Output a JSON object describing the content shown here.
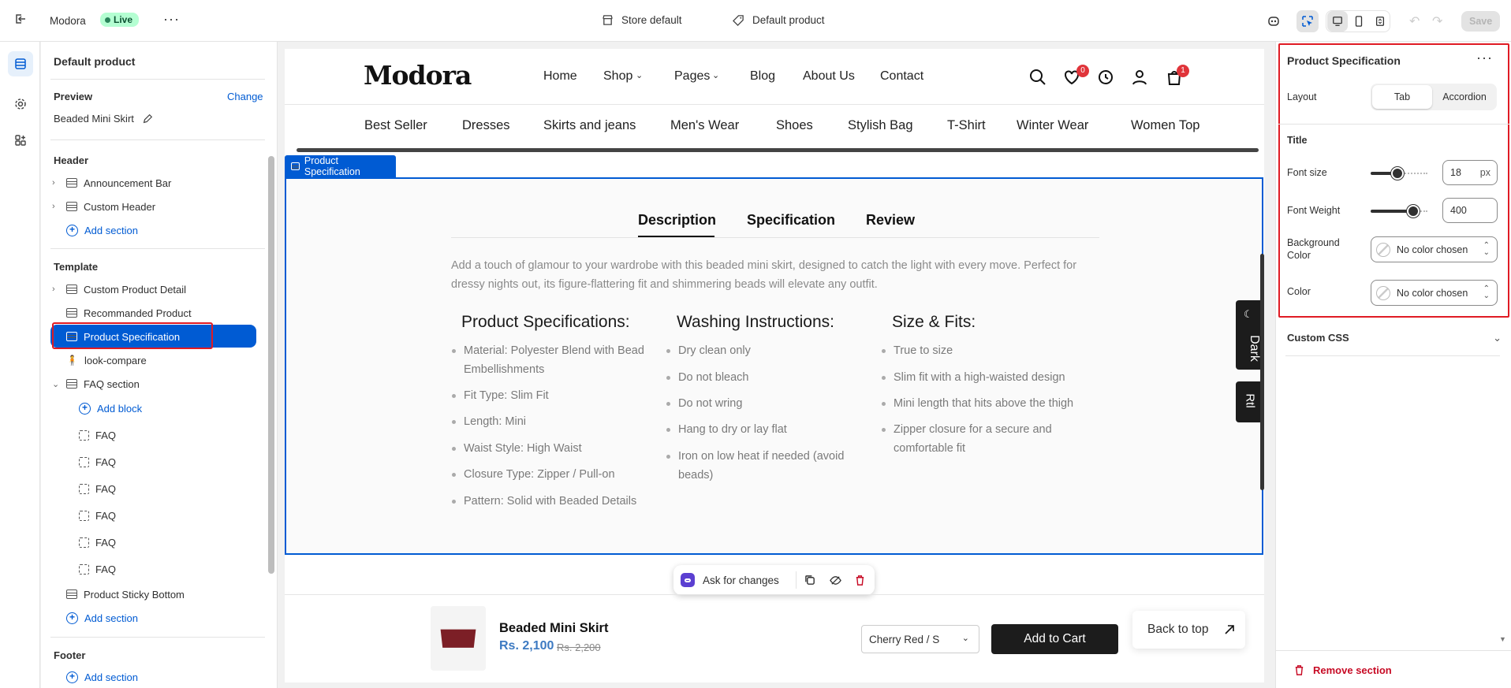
{
  "topbar": {
    "app_name": "Modora",
    "live": "Live",
    "store_default": "Store default",
    "default_product": "Default product",
    "save": "Save"
  },
  "left": {
    "title": "Default product",
    "preview_label": "Preview",
    "change": "Change",
    "preview_value": "Beaded Mini Skirt",
    "header_label": "Header",
    "header_items": [
      "Announcement Bar",
      "Custom Header"
    ],
    "add_section": "Add section",
    "template_label": "Template",
    "template_items": [
      "Custom Product Detail",
      "Recommanded Product",
      "Product Specification",
      "look-compare",
      "FAQ section"
    ],
    "add_block": "Add block",
    "faq": "FAQ",
    "sticky": "Product Sticky Bottom",
    "footer_label": "Footer"
  },
  "store": {
    "logo": "Modora",
    "nav": [
      "Home",
      "Shop",
      "Pages",
      "Blog",
      "About Us",
      "Contact"
    ],
    "wishlist_count": "0",
    "cart_count": "1",
    "categories": [
      "Best Seller",
      "Dresses",
      "Skirts and jeans",
      "Men's Wear",
      "Shoes",
      "Stylish Bag",
      "T-Shirt",
      "Winter Wear",
      "Women Top"
    ]
  },
  "section": {
    "tag": "Product Specification",
    "tabs": [
      "Description",
      "Specification",
      "Review"
    ],
    "description": "Add a touch of glamour to your wardrobe with this beaded mini skirt, designed to catch the light with every move. Perfect for dressy nights out, its figure-flattering fit and shimmering beads will elevate any outfit.",
    "col1_title": "Product Specifications:",
    "col1": [
      "Material: Polyester Blend with Bead Embellishments",
      "Fit Type: Slim Fit",
      "Length: Mini",
      "Waist Style: High Waist",
      "Closure Type: Zipper / Pull-on",
      "Pattern: Solid with Beaded Details"
    ],
    "col2_title": "Washing Instructions:",
    "col2": [
      "Dry clean only",
      "Do not bleach",
      "Do not wring",
      "Hang to dry or lay flat",
      "Iron on low heat if needed (avoid beads)"
    ],
    "col3_title": "Size & Fits:",
    "col3": [
      "True to size",
      "Slim fit with a high-waisted design",
      "Mini length that hits above the thigh",
      "Zipper closure for a secure and comfortable fit"
    ],
    "dark": "Dark",
    "rtl": "Rtl"
  },
  "toolbar": {
    "ask": "Ask for changes"
  },
  "sticky": {
    "name": "Beaded Mini Skirt",
    "price": "Rs. 2,100",
    "compare": "Rs. 2,200",
    "variant": "Cherry Red / S",
    "add_cart": "Add to Cart",
    "back_top": "Back to top"
  },
  "right": {
    "title": "Product Specification",
    "layout_label": "Layout",
    "tab": "Tab",
    "accordion": "Accordion",
    "title_label": "Title",
    "font_size_label": "Font size",
    "font_size": "18",
    "px": "px",
    "font_weight_label": "Font Weight",
    "font_weight": "400",
    "bg_label": "Background Color",
    "no_color": "No color chosen",
    "color_label": "Color",
    "custom_css": "Custom CSS",
    "remove": "Remove section"
  }
}
